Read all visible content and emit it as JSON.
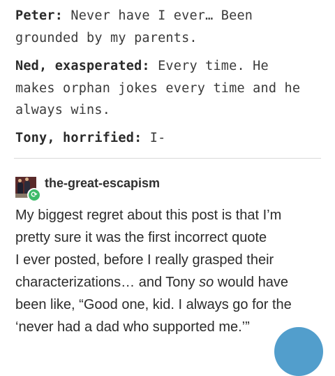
{
  "quote": {
    "lines": [
      {
        "speaker": "Peter:",
        "text": " Never have I ever… Been"
      },
      {
        "speaker": "",
        "text": "grounded by my parents."
      },
      {
        "speaker": "Ned, exasperated:",
        "text": " Every time. He"
      },
      {
        "speaker": "",
        "text": "makes orphan jokes every time and he"
      },
      {
        "speaker": "",
        "text": "always wins."
      },
      {
        "speaker": "Tony, horrified:",
        "text": " I-"
      }
    ]
  },
  "reblog": {
    "username": "the-great-escapism",
    "badge_icon": "reblog-icon",
    "badge_color": "#3dbb6a"
  },
  "comment": {
    "lines": [
      "My biggest regret about this post is that I’m",
      "pretty sure it was the first incorrect quote",
      "I ever posted, before I really grasped their",
      "characterizations… and Tony ",
      "been like, “Good one, kid. I always go for the",
      "‘never had a dad who supported me.’”"
    ],
    "emphasis_word": "so",
    "line4_tail": " would have"
  },
  "colors": {
    "fab": "#529ecc"
  }
}
